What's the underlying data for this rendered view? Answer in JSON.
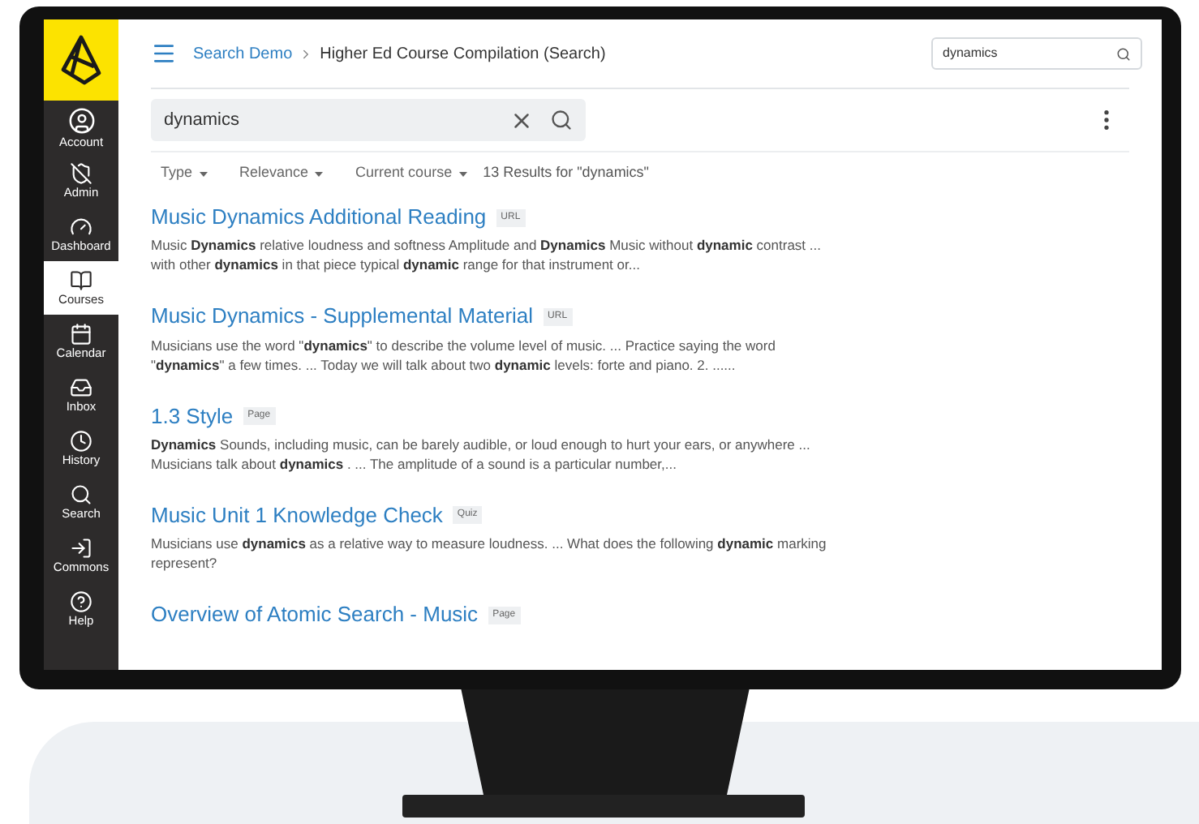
{
  "sidebar": {
    "items": [
      {
        "label": "Account",
        "selected": false
      },
      {
        "label": "Admin",
        "selected": false
      },
      {
        "label": "Dashboard",
        "selected": false
      },
      {
        "label": "Courses",
        "selected": true
      },
      {
        "label": "Calendar",
        "selected": false
      },
      {
        "label": "Inbox",
        "selected": false
      },
      {
        "label": "History",
        "selected": false
      },
      {
        "label": "Search",
        "selected": false
      },
      {
        "label": "Commons",
        "selected": false
      },
      {
        "label": "Help",
        "selected": false
      }
    ]
  },
  "header": {
    "breadcrumb": [
      "Search Demo",
      "Higher Ed Course Compilation (Search)"
    ],
    "search": {
      "value": "dynamics"
    }
  },
  "search_bar": {
    "value": "dynamics"
  },
  "filters": [
    "Type",
    "Relevance",
    "Current course"
  ],
  "result_count": "13 Results for \"dynamics\"",
  "results": [
    {
      "title": "Music Dynamics Additional Reading",
      "tag": "URL",
      "snippet": "Music **Dynamics** relative loudness and softness Amplitude and **Dynamics** Music without **dynamic** contrast ... with other **dynamics** in that piece typical **dynamic** range for that instrument or..."
    },
    {
      "title": "Music Dynamics - Supplemental Material",
      "tag": "URL",
      "snippet": "Musicians use the word \"**dynamics**\" to describe the volume level of music. ... Practice saying the word \"**dynamics**\" a few times. ... Today we will talk about two **dynamic** levels: forte and piano. 2. ......"
    },
    {
      "title": "1.3 Style",
      "tag": "Page",
      "snippet": " **Dynamics** Sounds, including music, can be barely audible, or loud enough to hurt your ears, or anywhere ... Musicians talk about  **dynamics** . ... The amplitude of a sound is a particular number,..."
    },
    {
      "title": "Music Unit 1 Knowledge Check",
      "tag": "Quiz",
      "snippet": "Musicians use **dynamics** as a relative way to measure loudness. ... What does the following **dynamic** marking represent?"
    },
    {
      "title": "Overview of Atomic Search - Music",
      "tag": "Page"
    }
  ]
}
